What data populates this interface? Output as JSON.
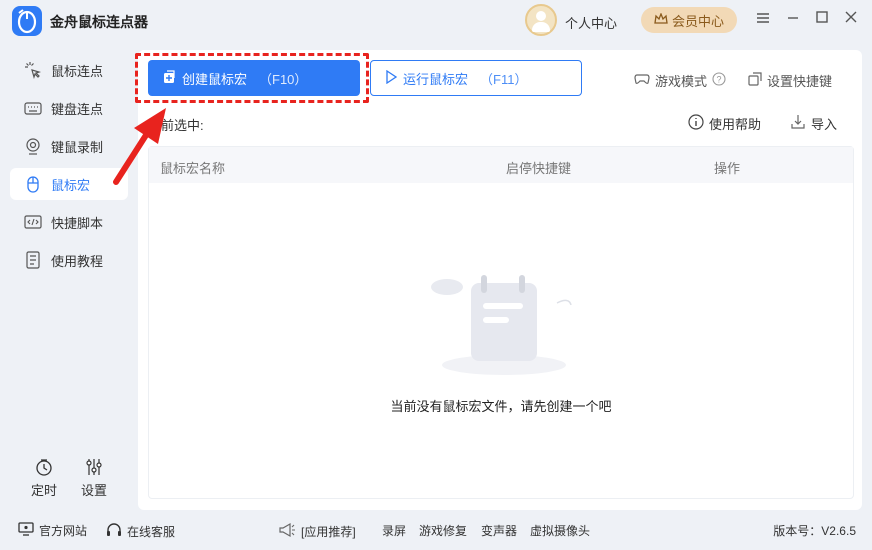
{
  "app": {
    "title": "金舟鼠标连点器"
  },
  "header": {
    "personal_center": "个人中心",
    "vip_center": "会员中心"
  },
  "sidebar": {
    "items": [
      {
        "label": "鼠标连点",
        "icon": "mouse-click-icon"
      },
      {
        "label": "键盘连点",
        "icon": "keyboard-icon"
      },
      {
        "label": "键鼠录制",
        "icon": "record-icon"
      },
      {
        "label": "鼠标宏",
        "icon": "mouse-icon"
      },
      {
        "label": "快捷脚本",
        "icon": "code-icon"
      },
      {
        "label": "使用教程",
        "icon": "tutorial-icon"
      }
    ],
    "active_index": 3,
    "timer_label": "定时",
    "settings_label": "设置"
  },
  "toolbar": {
    "create_label": "创建鼠标宏",
    "create_key": "（F10）",
    "run_label": "运行鼠标宏",
    "run_key": "（F11）",
    "game_mode": "游戏模式",
    "set_hotkey": "设置快捷键"
  },
  "main": {
    "current_selected": "当前选中:",
    "help": "使用帮助",
    "import": "导入",
    "columns": [
      "鼠标宏名称",
      "启停快捷键",
      "操作"
    ],
    "empty_text": "当前没有鼠标宏文件，请先创建一个吧"
  },
  "footer": {
    "website": "官方网站",
    "support": "在线客服",
    "app_recommend": "[应用推荐]",
    "links": [
      "录屏",
      "游戏修复",
      "变声器",
      "虚拟摄像头"
    ],
    "version": "版本号：V2.6.5"
  },
  "colors": {
    "accent": "#2f7bf5",
    "highlight": "#e8231e",
    "vip": "#f2d9b6"
  }
}
